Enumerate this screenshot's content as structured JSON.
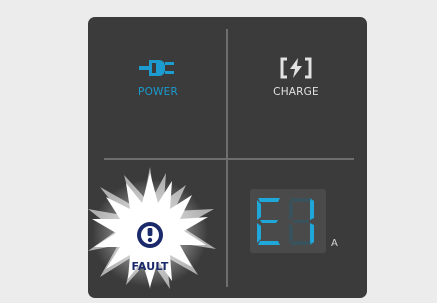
{
  "panel": {
    "power": {
      "label": "POWER",
      "icon": "plug-icon",
      "color": "#1b9bcf"
    },
    "charge": {
      "label": "CHARGE",
      "icon": "bracket-lightning-icon",
      "color": "#e2e2e2"
    },
    "fault": {
      "label": "FAULT",
      "icon": "exclamation-circle-icon",
      "color": "#1a2a6a"
    },
    "display": {
      "code": "E1",
      "unit": "A",
      "segment_color": "#1ea7d8"
    }
  }
}
